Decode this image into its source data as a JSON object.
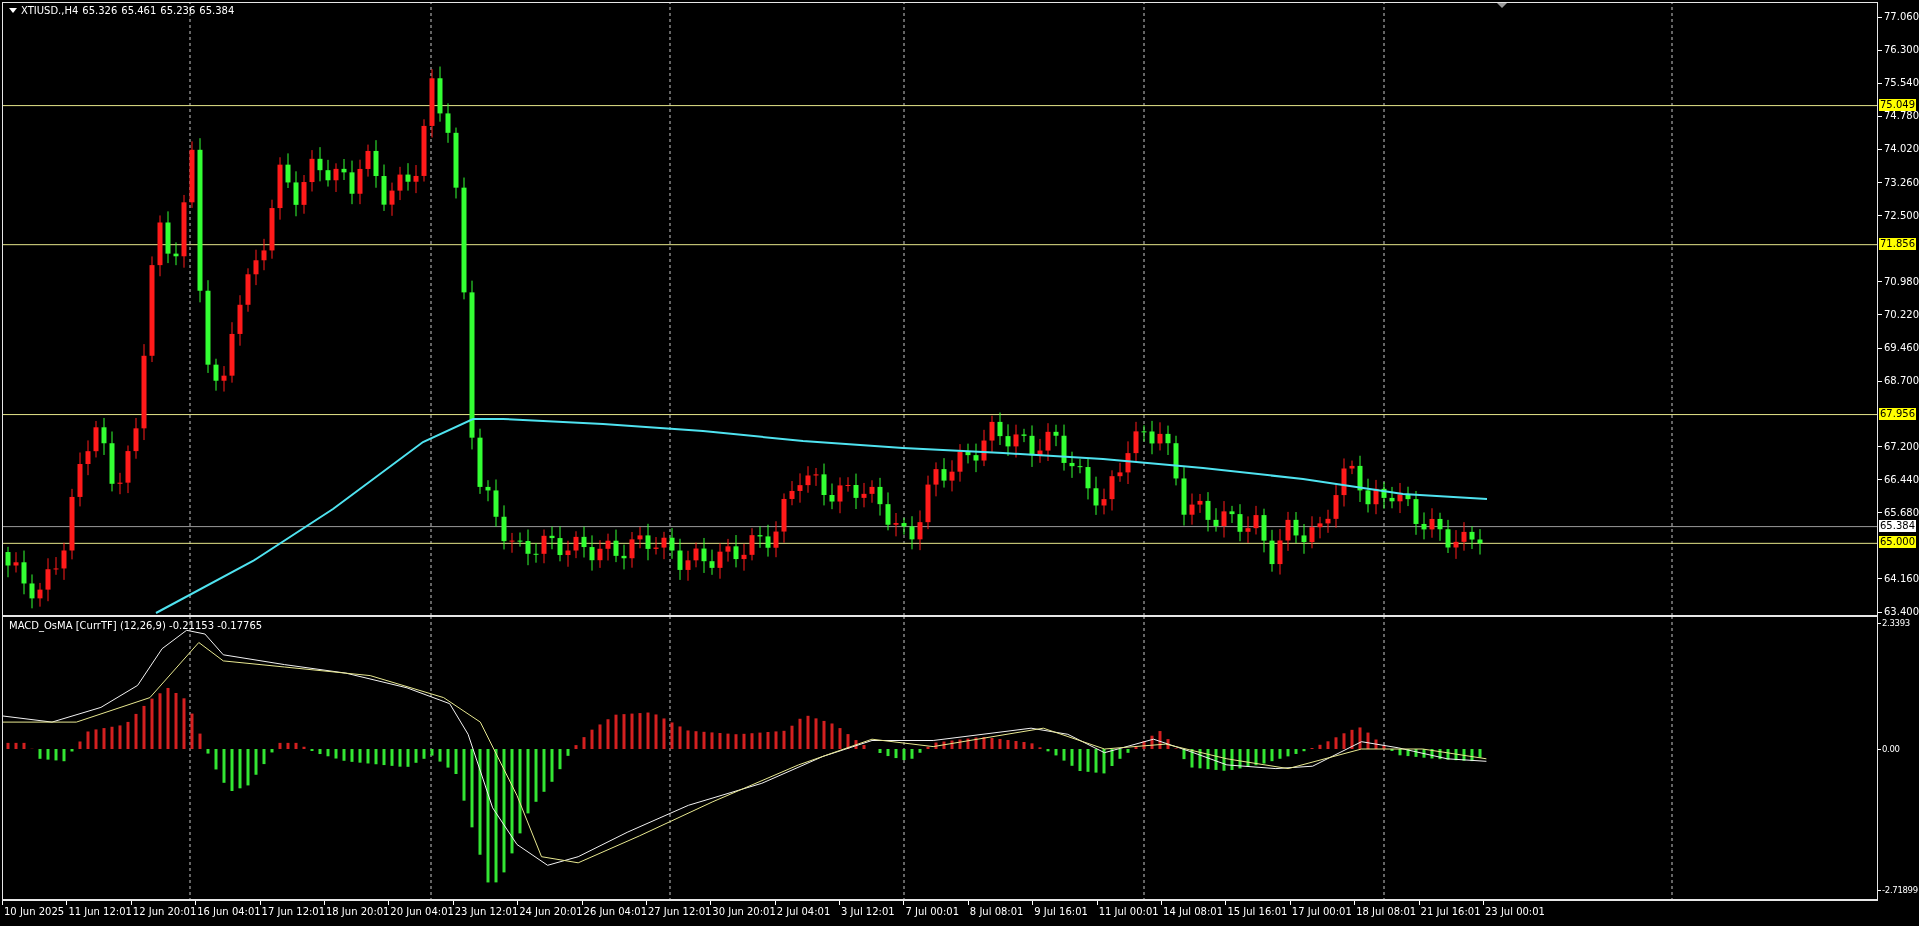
{
  "header": {
    "symbol": "XTIUSD.,H4",
    "ohlc": [
      "65.326",
      "65.461",
      "65.236",
      "65.384"
    ]
  },
  "price_axis": [
    "77.060",
    "76.300",
    "75.540",
    "74.780",
    "74.020",
    "73.260",
    "72.500",
    "70.980",
    "70.220",
    "69.460",
    "68.700",
    "67.200",
    "66.440",
    "65.680",
    "64.160",
    "63.400"
  ],
  "levels": [
    {
      "label": "75.049",
      "kind": "level"
    },
    {
      "label": "71.856",
      "kind": "level"
    },
    {
      "label": "67.956",
      "kind": "level"
    },
    {
      "label": "65.384",
      "kind": "bid"
    },
    {
      "label": "65.000",
      "kind": "level"
    }
  ],
  "macd": {
    "title": "MACD_OsMA [CurrTF] (12,26,9) -0.21153 -0.17765",
    "ticks": [
      "2.3393",
      "0.00",
      "-2.71899"
    ]
  },
  "time_axis": [
    "10 Jun 2025",
    "11 Jun 12:01",
    "12 Jun 20:01",
    "16 Jun 04:01",
    "17 Jun 12:01",
    "18 Jun 20:01",
    "20 Jun 04:01",
    "23 Jun 12:01",
    "24 Jun 20:01",
    "26 Jun 04:01",
    "27 Jun 12:01",
    "30 Jun 20:01",
    "2 Jul 04:01",
    "3 Jul 12:01",
    "7 Jul 00:01",
    "8 Jul 08:01",
    "9 Jul 16:01",
    "11 Jul 00:01",
    "14 Jul 08:01",
    "15 Jul 16:01",
    "17 Jul 00:01",
    "18 Jul 08:01",
    "21 Jul 16:01",
    "23 Jul 00:01"
  ]
}
